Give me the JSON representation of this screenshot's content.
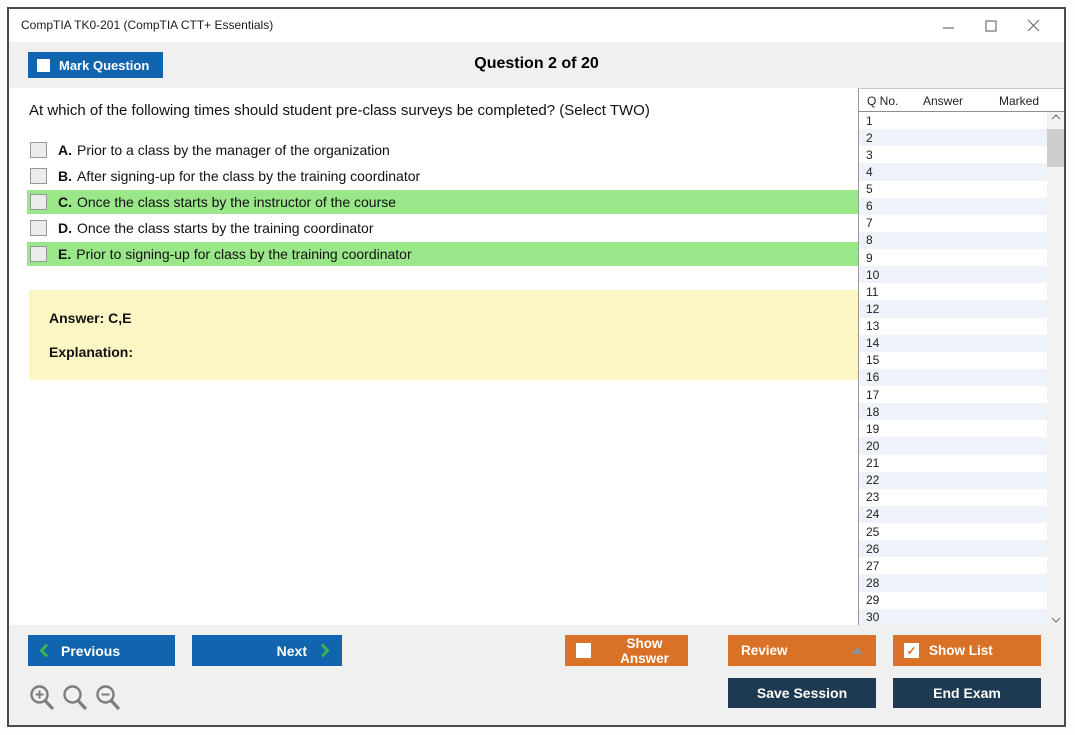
{
  "window": {
    "title": "CompTIA TK0-201 (CompTIA CTT+ Essentials)"
  },
  "header": {
    "mark_question_label": "Mark Question",
    "mark_question_checked": false,
    "question_counter": "Question 2 of 20"
  },
  "question": {
    "text": "At which of the following times should student pre-class surveys be completed? (Select TWO)",
    "options": [
      {
        "letter": "A.",
        "text": "Prior to a class by the manager of the organization",
        "highlighted": false,
        "checked": false
      },
      {
        "letter": "B.",
        "text": "After signing-up for the class by the training coordinator",
        "highlighted": false,
        "checked": false
      },
      {
        "letter": "C.",
        "text": "Once the class starts by the instructor of the course",
        "highlighted": true,
        "checked": false
      },
      {
        "letter": "D.",
        "text": "Once the class starts by the training coordinator",
        "highlighted": false,
        "checked": false
      },
      {
        "letter": "E.",
        "text": "Prior to signing-up for class by the training coordinator",
        "highlighted": true,
        "checked": false
      }
    ],
    "answer_label": "Answer: C,E",
    "explanation_label": "Explanation:"
  },
  "question_list": {
    "columns": [
      "Q No.",
      "Answer",
      "Marked"
    ],
    "rows": [
      {
        "q": "1",
        "answer": "",
        "marked": ""
      },
      {
        "q": "2",
        "answer": "",
        "marked": ""
      },
      {
        "q": "3",
        "answer": "",
        "marked": ""
      },
      {
        "q": "4",
        "answer": "",
        "marked": ""
      },
      {
        "q": "5",
        "answer": "",
        "marked": ""
      },
      {
        "q": "6",
        "answer": "",
        "marked": ""
      },
      {
        "q": "7",
        "answer": "",
        "marked": ""
      },
      {
        "q": "8",
        "answer": "",
        "marked": ""
      },
      {
        "q": "9",
        "answer": "",
        "marked": ""
      },
      {
        "q": "10",
        "answer": "",
        "marked": ""
      },
      {
        "q": "11",
        "answer": "",
        "marked": ""
      },
      {
        "q": "12",
        "answer": "",
        "marked": ""
      },
      {
        "q": "13",
        "answer": "",
        "marked": ""
      },
      {
        "q": "14",
        "answer": "",
        "marked": ""
      },
      {
        "q": "15",
        "answer": "",
        "marked": ""
      },
      {
        "q": "16",
        "answer": "",
        "marked": ""
      },
      {
        "q": "17",
        "answer": "",
        "marked": ""
      },
      {
        "q": "18",
        "answer": "",
        "marked": ""
      },
      {
        "q": "19",
        "answer": "",
        "marked": ""
      },
      {
        "q": "20",
        "answer": "",
        "marked": ""
      },
      {
        "q": "21",
        "answer": "",
        "marked": ""
      },
      {
        "q": "22",
        "answer": "",
        "marked": ""
      },
      {
        "q": "23",
        "answer": "",
        "marked": ""
      },
      {
        "q": "24",
        "answer": "",
        "marked": ""
      },
      {
        "q": "25",
        "answer": "",
        "marked": ""
      },
      {
        "q": "26",
        "answer": "",
        "marked": ""
      },
      {
        "q": "27",
        "answer": "",
        "marked": ""
      },
      {
        "q": "28",
        "answer": "",
        "marked": ""
      },
      {
        "q": "29",
        "answer": "",
        "marked": ""
      },
      {
        "q": "30",
        "answer": "",
        "marked": ""
      }
    ]
  },
  "footer": {
    "previous_label": "Previous",
    "next_label": "Next",
    "show_answer_label": "Show Answer",
    "show_answer_checked": false,
    "review_label": "Review",
    "show_list_label": "Show List",
    "show_list_checked": true,
    "save_session_label": "Save Session",
    "end_exam_label": "End Exam",
    "show_list_check_glyph": "✓"
  },
  "colors": {
    "accent_blue": "#1065ae",
    "accent_orange": "#d97127",
    "navy": "#1d3a52",
    "highlight_green": "#9ae78a",
    "answer_yellow": "#fcf6c5",
    "row_alt_blue": "#edf3f9",
    "bar_gray": "#f0f0f0",
    "chevron_green": "#3bb24a",
    "window_border": "#4b4b4b"
  }
}
